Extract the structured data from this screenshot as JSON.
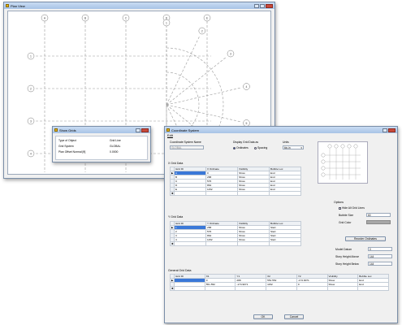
{
  "plan_view": {
    "title": "Plan View",
    "x_grid_bubbles": [
      "A",
      "B",
      "C",
      "D",
      "E"
    ],
    "y_grid_bubbles": [
      "1",
      "2",
      "3",
      "4"
    ],
    "radial_bubbles": [
      "1",
      "2",
      "3",
      "4",
      "5",
      "6",
      "7",
      "8"
    ]
  },
  "show_grids": {
    "title": "Show Grids",
    "rows": [
      {
        "label": "Type of Object",
        "value": "Grid Line"
      },
      {
        "label": "Grid System",
        "value": "GLOBAL"
      },
      {
        "label": "Plan Offset Normal  [ft]",
        "value": "0.0000"
      }
    ]
  },
  "coord_system": {
    "title": "Coordinate System",
    "menu_edit": "Edit",
    "system_name_label": "Coordinate System Name",
    "system_name_value": "GLOBAL",
    "display_label": "Display Grid Data as",
    "radio_ordinates": "Ordinates",
    "radio_spacing": "Spacing",
    "units_label": "Units",
    "units_value": "kip-in",
    "x_grid_label": "X Grid Data",
    "x_headers": [
      "Grid ID",
      "X Ordinate",
      "Visibility",
      "Bubble Loc"
    ],
    "x_rows": [
      [
        "A",
        "0",
        "Show",
        "End"
      ],
      [
        "B",
        "288",
        "Show",
        "End"
      ],
      [
        "C",
        "576",
        "Show",
        "End"
      ],
      [
        "D",
        "864",
        "Show",
        "End"
      ],
      [
        "E",
        "1152",
        "Show",
        "End"
      ]
    ],
    "y_grid_label": "Y Grid Data",
    "y_headers": [
      "Grid ID",
      "Y Ordinate",
      "Visibility",
      "Bubble Loc"
    ],
    "y_rows": [
      [
        "1",
        "288",
        "Show",
        "Start"
      ],
      [
        "2",
        "576",
        "Show",
        "Start"
      ],
      [
        "3",
        "864",
        "Show",
        "Start"
      ],
      [
        "4",
        "1152",
        "Show",
        "Start"
      ]
    ],
    "general_label": "General Grid Data",
    "g_headers": [
      "Grid ID",
      "X1",
      "Y1",
      "X2",
      "Y2",
      "Visibility",
      "Bubble Loc"
    ],
    "g_rows": [
      [
        "",
        "0",
        "288",
        "551.552",
        "-174.9071",
        "Show",
        "End"
      ],
      [
        "",
        "551.552",
        "-174.9071",
        "1152",
        "0",
        "Show",
        "End"
      ]
    ],
    "options_label": "Options",
    "hide_all": "Hide All Grid Lines",
    "bubble_size_label": "Bubble Size",
    "bubble_size_value": "60",
    "grid_color_label": "Grid Color",
    "reorder_btn": "Reorder Ordinates",
    "model_datum_label": "Model Datum",
    "model_datum_value": "0",
    "story_above_label": "Story Height Above",
    "story_above_value": "144",
    "story_below_label": "Story Height Below",
    "story_below_value": "144",
    "ok": "OK",
    "cancel": "Cancel"
  },
  "colors": {
    "titlebar": "#b8cfee",
    "selection": "#3a78d8",
    "grid_dash": "#9a9a9a"
  }
}
